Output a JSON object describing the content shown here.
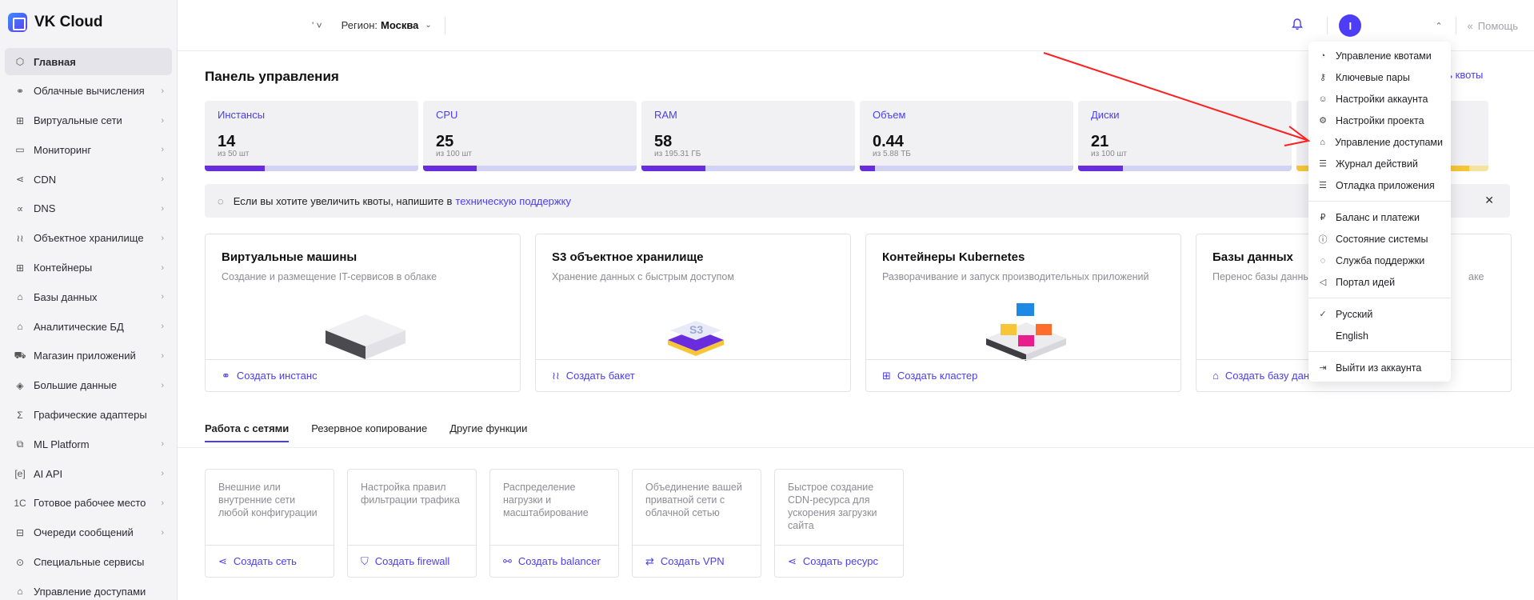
{
  "brand": {
    "name": "VK Cloud"
  },
  "sidebar": {
    "items": [
      {
        "label": "Главная",
        "icon": "cube-icon",
        "glyph": "⬡",
        "has_chevron": false,
        "active": true
      },
      {
        "label": "Облачные вычисления",
        "icon": "cloud-compute-icon",
        "glyph": "⚭",
        "has_chevron": true
      },
      {
        "label": "Виртуальные сети",
        "icon": "network-icon",
        "glyph": "⊞",
        "has_chevron": true
      },
      {
        "label": "Мониторинг",
        "icon": "monitoring-icon",
        "glyph": "▭",
        "has_chevron": true
      },
      {
        "label": "CDN",
        "icon": "cdn-icon",
        "glyph": "⋖",
        "has_chevron": true
      },
      {
        "label": "DNS",
        "icon": "dns-icon",
        "glyph": "∝",
        "has_chevron": true
      },
      {
        "label": "Объектное хранилище",
        "icon": "storage-icon",
        "glyph": "≀≀",
        "has_chevron": true
      },
      {
        "label": "Контейнеры",
        "icon": "containers-icon",
        "glyph": "⊞",
        "has_chevron": true
      },
      {
        "label": "Базы данных",
        "icon": "database-icon",
        "glyph": "⌂",
        "has_chevron": true
      },
      {
        "label": "Аналитические БД",
        "icon": "analytics-db-icon",
        "glyph": "⌂",
        "has_chevron": true
      },
      {
        "label": "Магазин приложений",
        "icon": "app-store-icon",
        "glyph": "⛟",
        "has_chevron": true
      },
      {
        "label": "Большие данные",
        "icon": "big-data-icon",
        "glyph": "◈",
        "has_chevron": true
      },
      {
        "label": "Графические адаптеры",
        "icon": "gpu-icon",
        "glyph": "Σ",
        "has_chevron": false
      },
      {
        "label": "ML Platform",
        "icon": "ml-platform-icon",
        "glyph": "⧉",
        "has_chevron": true
      },
      {
        "label": "AI API",
        "icon": "ai-api-icon",
        "glyph": "[e]",
        "has_chevron": true
      },
      {
        "label": "Готовое рабочее место",
        "icon": "workplace-icon",
        "glyph": "1C",
        "has_chevron": true
      },
      {
        "label": "Очереди сообщений",
        "icon": "message-queue-icon",
        "glyph": "⊟",
        "has_chevron": true
      },
      {
        "label": "Специальные сервисы",
        "icon": "special-services-icon",
        "glyph": "⊙",
        "has_chevron": false
      },
      {
        "label": "Управление доступами",
        "icon": "access-icon",
        "glyph": "⌂",
        "has_chevron": false
      }
    ]
  },
  "topbar": {
    "project_text": "' ˅",
    "region_label": "Регион:",
    "region_value": "Москва",
    "avatar_letter": "I",
    "help_label": "Помощь"
  },
  "main": {
    "title": "Панель управления",
    "hide_quotas": "ыть квоты",
    "quotas": [
      {
        "name": "Инстансы",
        "value": "14",
        "limit": "из 50 шт",
        "fill": 0.28
      },
      {
        "name": "CPU",
        "value": "25",
        "limit": "из 100 шт",
        "fill": 0.25
      },
      {
        "name": "RAM",
        "value": "58",
        "limit": "из 195.31 ГБ",
        "fill": 0.3
      },
      {
        "name": "Объем",
        "value": "0.44",
        "limit": "из 5.88 ТБ",
        "fill": 0.07
      },
      {
        "name": "Диски",
        "value": "21",
        "limit": "из 100 шт",
        "fill": 0.21
      },
      {
        "name": "",
        "value": "",
        "limit": "",
        "fill": 0.9
      }
    ],
    "notice": {
      "text": "Если вы хотите увеличить квоты, напишите в",
      "link": "техническую поддержку"
    },
    "cards": [
      {
        "title": "Виртуальные машины",
        "desc": "Создание и размещение IT-сервисов в облаке",
        "action": "Создать инстанс",
        "icon": "instance-icon",
        "glyph": "⚭"
      },
      {
        "title": "S3 объектное хранилище",
        "desc": "Хранение данных с быстрым доступом",
        "action": "Создать бакет",
        "icon": "bucket-icon",
        "glyph": "≀≀"
      },
      {
        "title": "Контейнеры Kubernetes",
        "desc": "Разворачивание и запуск производительных приложений",
        "action": "Создать кластер",
        "icon": "cluster-icon",
        "glyph": "⊞"
      },
      {
        "title": "Базы данных",
        "desc": "Перенос базы данных",
        "desc_tail": "аке",
        "action": "Создать базу данн",
        "icon": "database-create-icon",
        "glyph": "⌂"
      }
    ],
    "tabs": [
      {
        "label": "Работа с сетями",
        "active": true
      },
      {
        "label": "Резервное копирование",
        "active": false
      },
      {
        "label": "Другие функции",
        "active": false
      }
    ],
    "network_cards": [
      {
        "desc": "Внешние или внутренние сети любой конфигурации",
        "action": "Создать сеть",
        "icon": "network-create-icon",
        "glyph": "⋖"
      },
      {
        "desc": "Настройка правил фильтрации трафика",
        "action": "Создать firewall",
        "icon": "shield-icon",
        "glyph": "⛉"
      },
      {
        "desc": "Распределение нагрузки и масштабирование",
        "action": "Создать balancer",
        "icon": "balancer-icon",
        "glyph": "⚯"
      },
      {
        "desc": "Объединение вашей приватной сети с облачной сетью",
        "action": "Создать VPN",
        "icon": "vpn-icon",
        "glyph": "⇄"
      },
      {
        "desc": "Быстрое создание CDN-ресурса для ускорения загрузки сайта",
        "action": "Создать ресурс",
        "icon": "cdn-resource-icon",
        "glyph": "⋖"
      }
    ]
  },
  "user_menu": {
    "groups": [
      [
        {
          "label": "Управление квотами",
          "icon": "quota-icon",
          "glyph": "◔"
        },
        {
          "label": "Ключевые пары",
          "icon": "key-icon",
          "glyph": "⚷"
        },
        {
          "label": "Настройки аккаунта",
          "icon": "account-icon",
          "glyph": "☺"
        },
        {
          "label": "Настройки проекта",
          "icon": "gear-icon",
          "glyph": "⚙"
        },
        {
          "label": "Управление доступами",
          "icon": "access-icon",
          "glyph": "⌂"
        },
        {
          "label": "Журнал действий",
          "icon": "journal-icon",
          "glyph": "☰"
        },
        {
          "label": "Отладка приложения",
          "icon": "debug-icon",
          "glyph": "☰"
        }
      ],
      [
        {
          "label": "Баланс и платежи",
          "icon": "ruble-icon",
          "glyph": "₽"
        },
        {
          "label": "Состояние системы",
          "icon": "status-icon",
          "glyph": "ⓘ"
        },
        {
          "label": "Служба поддержки",
          "icon": "support-icon",
          "glyph": "◌"
        },
        {
          "label": "Портал идей",
          "icon": "megaphone-icon",
          "glyph": "◁"
        }
      ],
      [
        {
          "label": "Русский",
          "icon": "check-icon",
          "glyph": "✓"
        },
        {
          "label": "English",
          "icon": "",
          "glyph": ""
        }
      ],
      [
        {
          "label": "Выйти из аккаунта",
          "icon": "logout-icon",
          "glyph": "⇥"
        }
      ]
    ]
  },
  "colors": {
    "accent": "#4a3ef0",
    "quota_fill": "#6a2dde",
    "arrow": "#ff2020"
  }
}
